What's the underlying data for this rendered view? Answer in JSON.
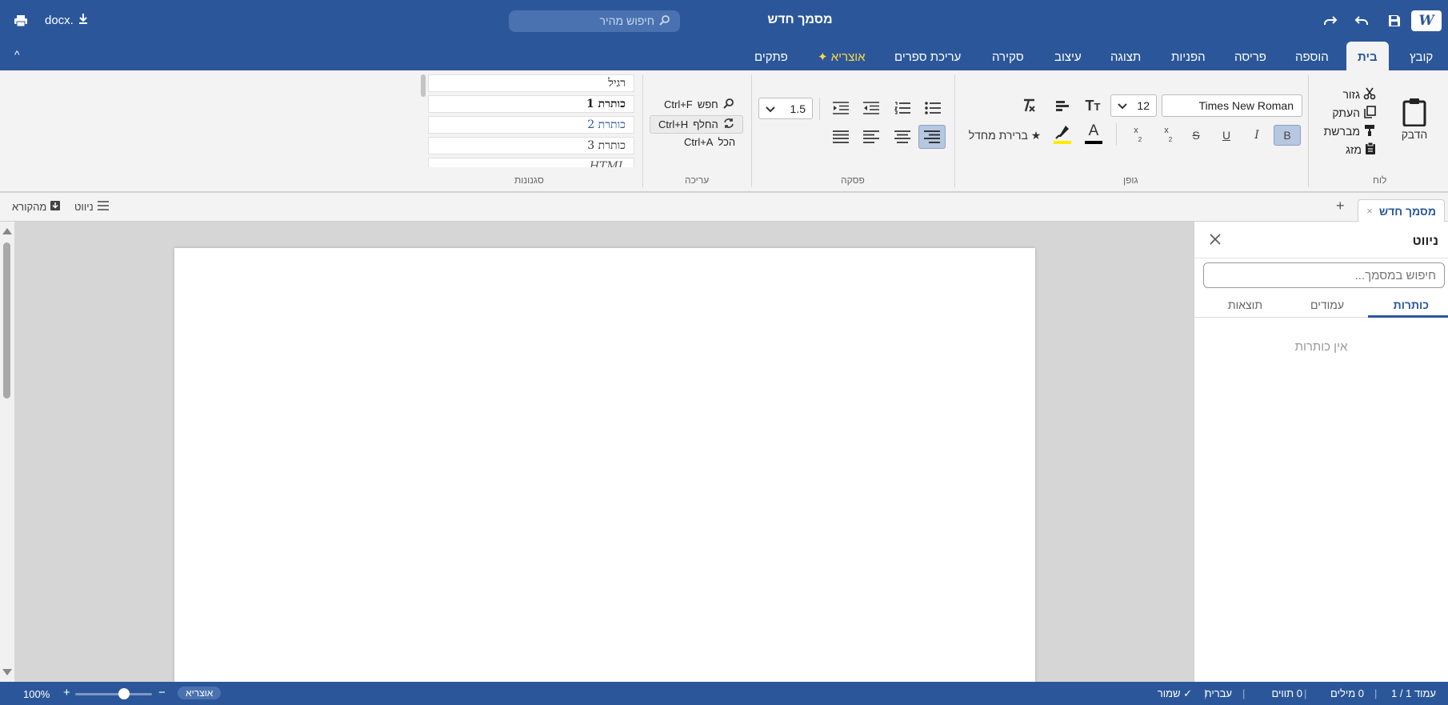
{
  "titlebar": {
    "logo": "W",
    "doc_title": "מסמך חדש",
    "search_placeholder": "חיפוש מהיר",
    "export_label": "docx."
  },
  "tabs": [
    {
      "label": "קובץ"
    },
    {
      "label": "בית",
      "active": true
    },
    {
      "label": "הוספה"
    },
    {
      "label": "פריסה"
    },
    {
      "label": "הפניות"
    },
    {
      "label": "תצוגה"
    },
    {
      "label": "עיצוב"
    },
    {
      "label": "סקירה"
    },
    {
      "label": "עריכת ספרים"
    },
    {
      "label": "✦ אוצריא"
    },
    {
      "label": "פתקים"
    }
  ],
  "ribbon": {
    "groups": {
      "clipboard": "לוח",
      "font": "גופן",
      "paragraph": "פסקה",
      "editing": "עריכה",
      "styles": "סגנונות"
    },
    "clipboard": {
      "paste": "הדבק",
      "cut": "גזור",
      "copy": "העתק",
      "format_painter": "מברשת",
      "merge": "מזג"
    },
    "font": {
      "family": "Times New Roman",
      "size": "12",
      "bold": "B",
      "italic": "I",
      "underline": "U",
      "strike": "S",
      "subscript": "x",
      "superscript": "x",
      "script_digit": "2",
      "font_color": "A",
      "default_font": "★ ברירת מחדל",
      "highlight_color": "#ffeb00",
      "font_color_value": "#000000"
    },
    "paragraph": {
      "line_spacing": "1.5"
    },
    "editing": {
      "find": "חפש",
      "find_shortcut": "Ctrl+F",
      "replace": "החלף",
      "replace_shortcut": "Ctrl+H",
      "select_all": "הכל",
      "select_all_shortcut": "Ctrl+A"
    },
    "styles": [
      {
        "label": "רגיל"
      },
      {
        "label": "כותרת 1"
      },
      {
        "label": "כותרת 2"
      },
      {
        "label": "כותרת 3"
      },
      {
        "label": "HTML"
      }
    ]
  },
  "docbar": {
    "doc_tab": "מסמך חדש",
    "close": "×",
    "add": "+",
    "navigation": "ניווט",
    "reader": "מהקורא"
  },
  "navpane": {
    "title": "ניווט",
    "search_placeholder": "חיפוש במסמך...",
    "tabs": [
      {
        "label": "כותרות",
        "active": true
      },
      {
        "label": "עמודים"
      },
      {
        "label": "תוצאות"
      }
    ],
    "empty": "אין כותרות"
  },
  "statusbar": {
    "page": "עמוד 1 / 1",
    "words": "0 מילים",
    "chars": "0 תווים",
    "language": "עברית",
    "saved": "✓ שמור",
    "lang_badge": "אוצריא",
    "zoom_out": "−",
    "zoom_in": "+",
    "zoom": "100%",
    "zoom_level": 1.0
  },
  "colors": {
    "brand": "#2b579a",
    "ribbon_bg": "#f3f3f3",
    "ai_tab": "#ffd54a"
  }
}
